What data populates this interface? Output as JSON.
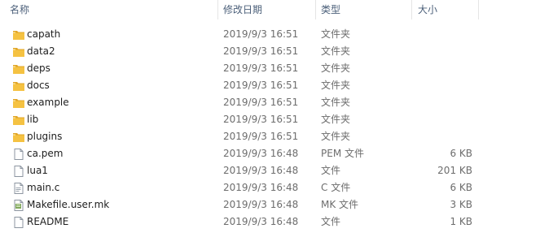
{
  "columns": {
    "name": "名称",
    "modified": "修改日期",
    "type": "类型",
    "size": "大小"
  },
  "sort_indicator": "^",
  "rows": [
    {
      "name": "capath",
      "modified": "2019/9/3 16:51",
      "type": "文件夹",
      "size": "",
      "icon": "folder-icon"
    },
    {
      "name": "data2",
      "modified": "2019/9/3 16:51",
      "type": "文件夹",
      "size": "",
      "icon": "folder-icon"
    },
    {
      "name": "deps",
      "modified": "2019/9/3 16:51",
      "type": "文件夹",
      "size": "",
      "icon": "folder-icon"
    },
    {
      "name": "docs",
      "modified": "2019/9/3 16:51",
      "type": "文件夹",
      "size": "",
      "icon": "folder-icon"
    },
    {
      "name": "example",
      "modified": "2019/9/3 16:51",
      "type": "文件夹",
      "size": "",
      "icon": "folder-icon"
    },
    {
      "name": "lib",
      "modified": "2019/9/3 16:51",
      "type": "文件夹",
      "size": "",
      "icon": "folder-icon"
    },
    {
      "name": "plugins",
      "modified": "2019/9/3 16:51",
      "type": "文件夹",
      "size": "",
      "icon": "folder-icon"
    },
    {
      "name": "ca.pem",
      "modified": "2019/9/3 16:48",
      "type": "PEM 文件",
      "size": "6 KB",
      "icon": "file-icon"
    },
    {
      "name": "lua1",
      "modified": "2019/9/3 16:48",
      "type": "文件",
      "size": "201 KB",
      "icon": "file-icon"
    },
    {
      "name": "main.c",
      "modified": "2019/9/3 16:48",
      "type": "C 文件",
      "size": "6 KB",
      "icon": "c-file-icon"
    },
    {
      "name": "Makefile.user.mk",
      "modified": "2019/9/3 16:48",
      "type": "MK 文件",
      "size": "3 KB",
      "icon": "mk-file-icon"
    },
    {
      "name": "README",
      "modified": "2019/9/3 16:48",
      "type": "文件",
      "size": "1 KB",
      "icon": "file-icon"
    }
  ],
  "colors": {
    "folder": "#f5c242",
    "folder_dark": "#e1a526",
    "header_text": "#4c607a",
    "row_text": "#1e1e1e",
    "meta_text": "#6d6d6d"
  }
}
